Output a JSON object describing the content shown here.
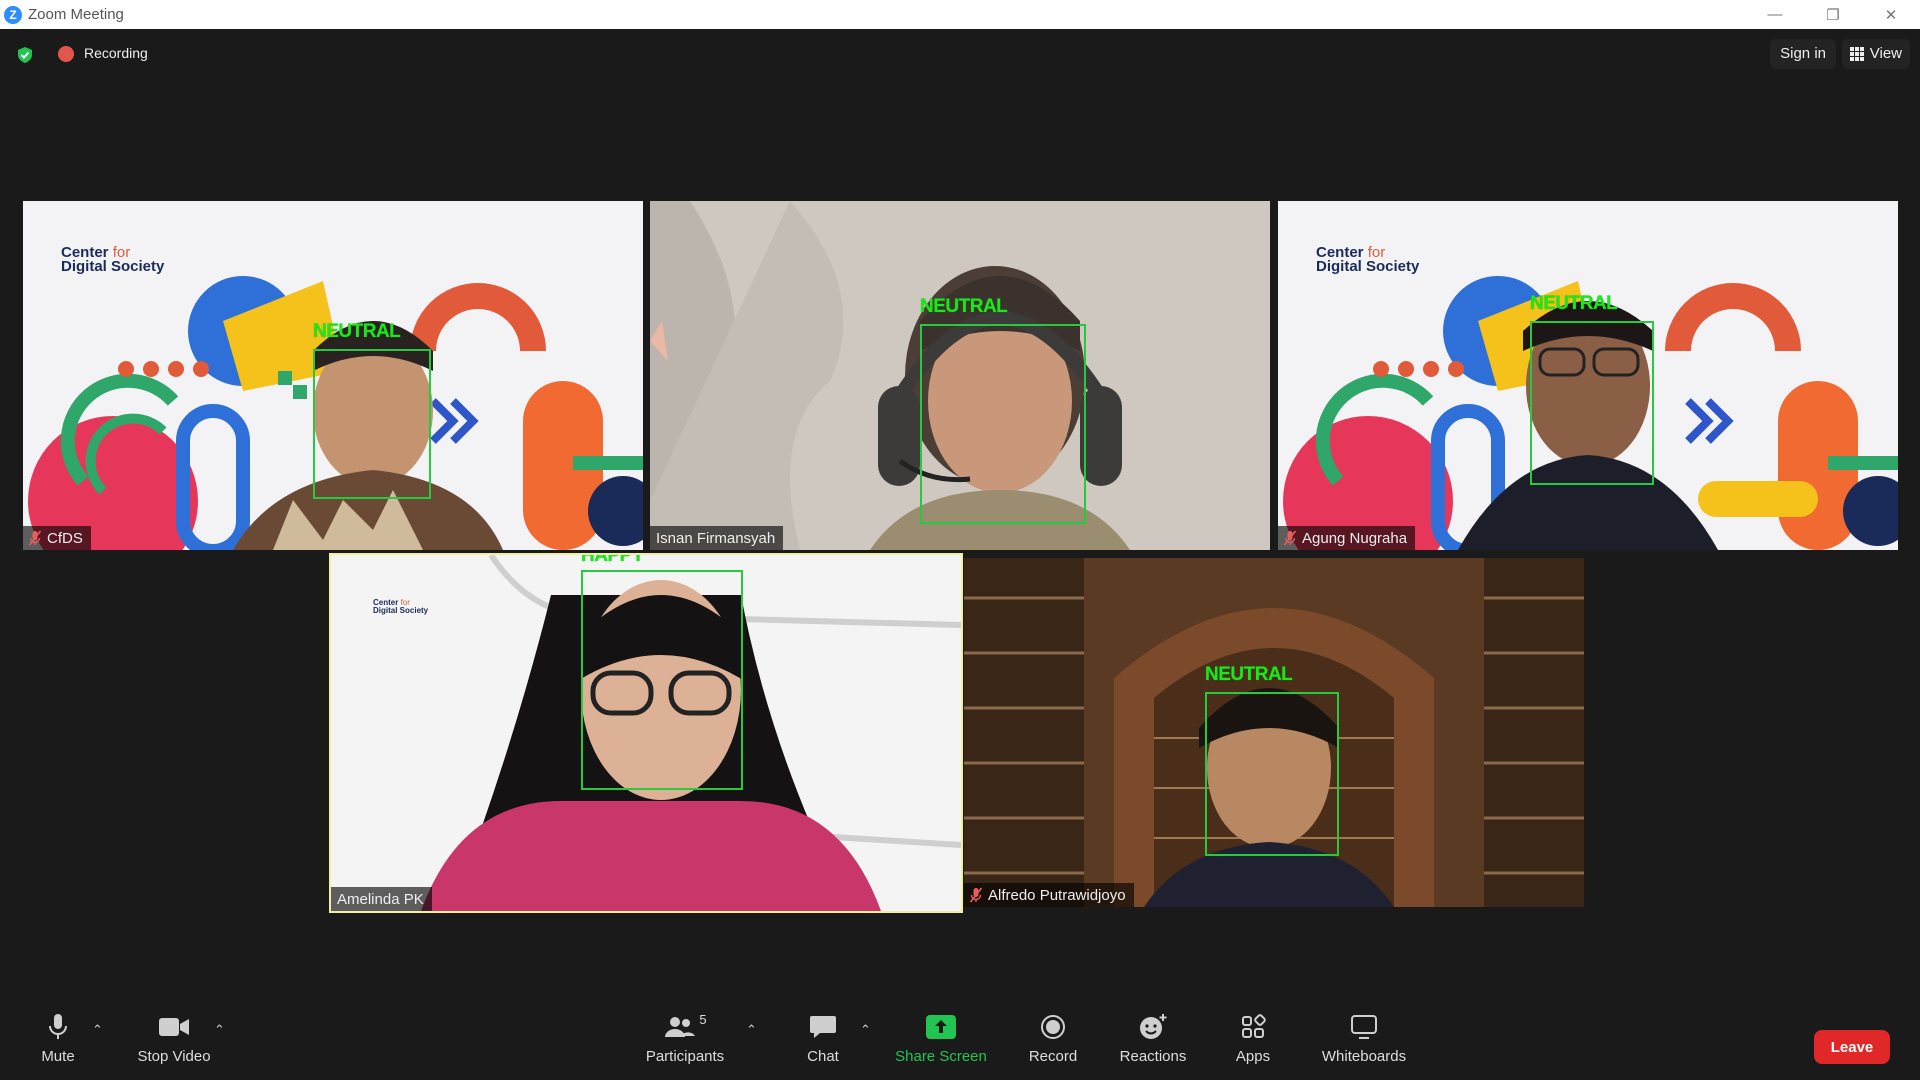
{
  "window": {
    "title": "Zoom Meeting",
    "logo_letter": "Z"
  },
  "top_bar": {
    "recording_label": "Recording",
    "signin_label": "Sign in",
    "view_label": "View"
  },
  "participants": [
    {
      "name": "CfDS",
      "emotion": "NEUTRAL",
      "muted": true,
      "brand_line1": "Center",
      "brand_for": "for",
      "brand_line2": "Digital Society"
    },
    {
      "name": "Isnan Firmansyah",
      "emotion": "NEUTRAL",
      "muted": false
    },
    {
      "name": "Agung Nugraha",
      "emotion": "NEUTRAL",
      "muted": true,
      "brand_line1": "Center",
      "brand_for": "for",
      "brand_line2": "Digital Society"
    },
    {
      "name": "Amelinda PK",
      "emotion": "HAPPY",
      "muted": false,
      "active_speaker": true,
      "brand_line1": "Center",
      "brand_for": "for",
      "brand_line2": "Digital Society"
    },
    {
      "name": "Alfredo Putrawidjoyo",
      "emotion": "NEUTRAL",
      "muted": true
    }
  ],
  "toolbar": {
    "mute_label": "Mute",
    "video_label": "Stop Video",
    "participants_label": "Participants",
    "participants_count": "5",
    "chat_label": "Chat",
    "share_label": "Share Screen",
    "record_label": "Record",
    "reactions_label": "Reactions",
    "apps_label": "Apps",
    "whiteboards_label": "Whiteboards",
    "leave_label": "Leave"
  },
  "colors": {
    "accent_green": "#1ee61e",
    "share_green": "#23c552",
    "leave_red": "#e02828",
    "zoom_blue": "#2d8cff"
  },
  "icons": [
    "shield-icon",
    "record-dot-icon",
    "grid-view-icon",
    "microphone-icon",
    "camera-icon",
    "participants-icon",
    "chat-icon",
    "share-screen-icon",
    "record-icon",
    "reactions-icon",
    "apps-icon",
    "whiteboard-icon",
    "muted-mic-icon"
  ]
}
